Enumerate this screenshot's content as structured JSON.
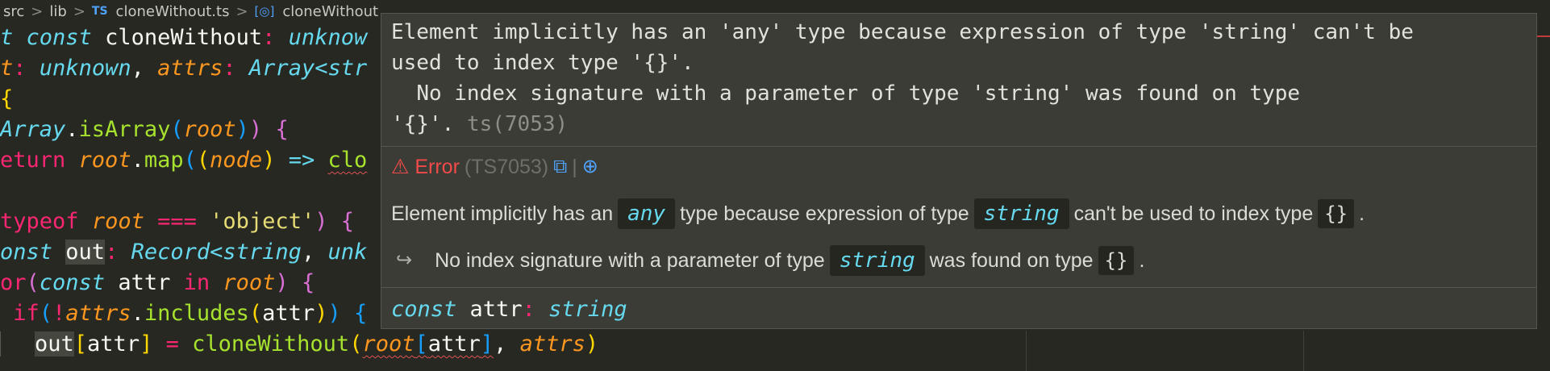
{
  "breadcrumb": {
    "items": [
      "src",
      "lib",
      "TS",
      "cloneWithout.ts",
      "cloneWithout"
    ],
    "separator": ">"
  },
  "code": {
    "lines": [
      [
        "t ",
        "const",
        " ",
        "cloneWithout",
        ":",
        " ",
        "unknow"
      ],
      [
        "t",
        ":",
        " ",
        "unknown",
        ", ",
        "attrs",
        ":",
        " ",
        "Array<str"
      ],
      [
        "{"
      ],
      [
        "Array",
        ".",
        "isArray",
        "(",
        "root",
        ")",
        ")",
        " ",
        "{"
      ],
      [
        "eturn",
        " ",
        "root",
        ".",
        "map",
        "(",
        "(",
        "node",
        ")",
        " ",
        "=>",
        " ",
        "clo"
      ],
      [
        ""
      ],
      [
        "typeof",
        " ",
        "root",
        " ",
        "===",
        " ",
        "'object'",
        ")",
        " ",
        "{"
      ],
      [
        "onst",
        " ",
        "out",
        ":",
        " ",
        "Record<string",
        ",",
        " ",
        "unk"
      ],
      [
        "or",
        "(",
        "const",
        " ",
        "attr",
        " ",
        "in",
        " ",
        "root",
        ")",
        " ",
        "{"
      ],
      [
        " ",
        "if",
        "(",
        "!",
        "attrs",
        ".",
        "includes",
        "(",
        "attr",
        ")",
        ")",
        " ",
        "{"
      ],
      [
        "out",
        "[",
        "attr",
        "]",
        " = ",
        "cloneWithout",
        "(",
        "root",
        "[",
        "attr",
        "]",
        ", ",
        "attrs",
        ")"
      ]
    ]
  },
  "hover": {
    "message": "Element implicitly has an 'any' type because expression of type 'string' can't be\nused to index type '{}'.\n  No index signature with a parameter of type 'string' was found on type\n'{}'.",
    "code_ref": "ts(7053)",
    "error_label": "⚠ Error",
    "error_code": "(TS7053)",
    "link_icon": "external-link-icon",
    "globe_icon": "globe-icon",
    "line1": {
      "t1": "Element implicitly has an",
      "c1": "any",
      "t2": "type because expression of type",
      "c2": "string",
      "t3": "can't be used to index type",
      "c3": "{}",
      "t4": "."
    },
    "line2": {
      "arrow": "↪",
      "t1": "No index signature with a parameter of type",
      "c1": "string",
      "t2": "was found on type",
      "c2": "{}",
      "t3": "."
    },
    "declaration": {
      "keyword": "const",
      "name": "attr",
      "colon": ":",
      "type": "string"
    }
  },
  "colors": {
    "background": "#272822",
    "hover_background": "#3b3c35",
    "error": "#f34a4a",
    "type": "#66d9ef",
    "function": "#a6e22e",
    "param": "#fd971f"
  }
}
